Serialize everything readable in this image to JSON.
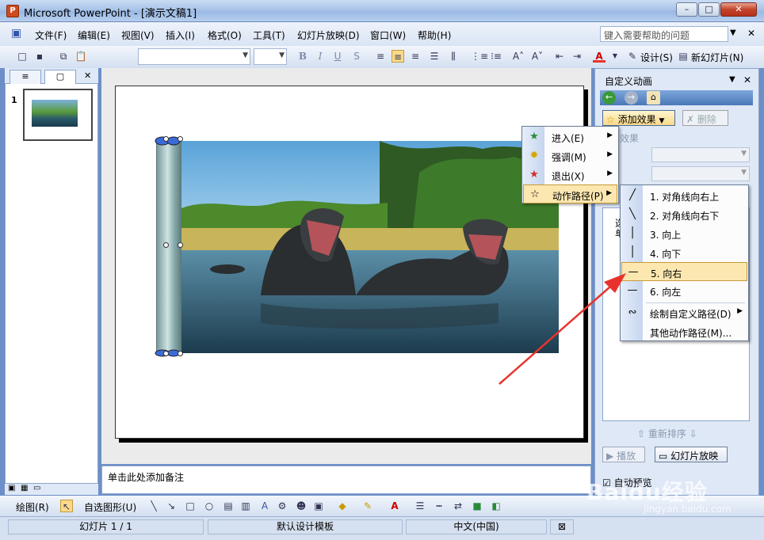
{
  "window": {
    "title": "Microsoft PowerPoint - [演示文稿1]",
    "app_icon": "P",
    "min": "–",
    "max": "□",
    "close": "✕"
  },
  "menubar": {
    "items": [
      "文件(F)",
      "编辑(E)",
      "视图(V)",
      "插入(I)",
      "格式(O)",
      "工具(T)",
      "幻灯片放映(D)",
      "窗口(W)",
      "帮助(H)"
    ],
    "help_placeholder": "键入需要帮助的问题"
  },
  "toolbar": {
    "design_label": "设计(S)",
    "new_slide_label": "新幻灯片(N)",
    "bold": "B",
    "italic": "I",
    "underline": "U",
    "shadow": "S",
    "font_color": "A"
  },
  "left_panel": {
    "tab_outline": "≡",
    "tab_slides": "▢",
    "close": "✕",
    "slide_number": "1"
  },
  "notes": {
    "placeholder": "单击此处添加备注"
  },
  "task_pane": {
    "title": "自定义动画",
    "add_effect": "添加效果",
    "delete": "删除",
    "modify_label": "效果",
    "list_text": "选\n单",
    "reorder": "重新排序",
    "play": "播放",
    "slideshow": "幻灯片放映",
    "autopreview": "自动预览"
  },
  "effect_menu": {
    "items": [
      {
        "label": "进入(E)",
        "icon": "green-star-icon"
      },
      {
        "label": "强调(M)",
        "icon": "yellow-star-icon"
      },
      {
        "label": "退出(X)",
        "icon": "red-star-icon"
      },
      {
        "label": "动作路径(P)",
        "icon": "outline-star-icon"
      }
    ]
  },
  "path_menu": {
    "items": [
      {
        "label": "1. 对角线向右上",
        "icon": "diagonal-up-icon"
      },
      {
        "label": "2. 对角线向右下",
        "icon": "diagonal-down-icon"
      },
      {
        "label": "3. 向上",
        "icon": "vertical-line-icon"
      },
      {
        "label": "4. 向下",
        "icon": "vertical-line-icon"
      },
      {
        "label": "5. 向右",
        "icon": "horizontal-line-icon"
      },
      {
        "label": "6. 向左",
        "icon": "horizontal-line-icon"
      },
      {
        "label": "绘制自定义路径(D)",
        "icon": "curve-icon"
      },
      {
        "label": "其他动作路径(M)...",
        "icon": ""
      }
    ],
    "highlighted_index": 4
  },
  "drawbar": {
    "draw_label": "绘图(R)",
    "autoshape_label": "自选图形(U)"
  },
  "statusbar": {
    "slide": "幻灯片 1 / 1",
    "template": "默认设计模板",
    "language": "中文(中国)"
  },
  "watermark": {
    "brand": "Baidu经验",
    "url": "jingyan.baidu.com"
  },
  "colors": {
    "accent_red": "#e8332c",
    "highlight": "#fde7b0"
  }
}
